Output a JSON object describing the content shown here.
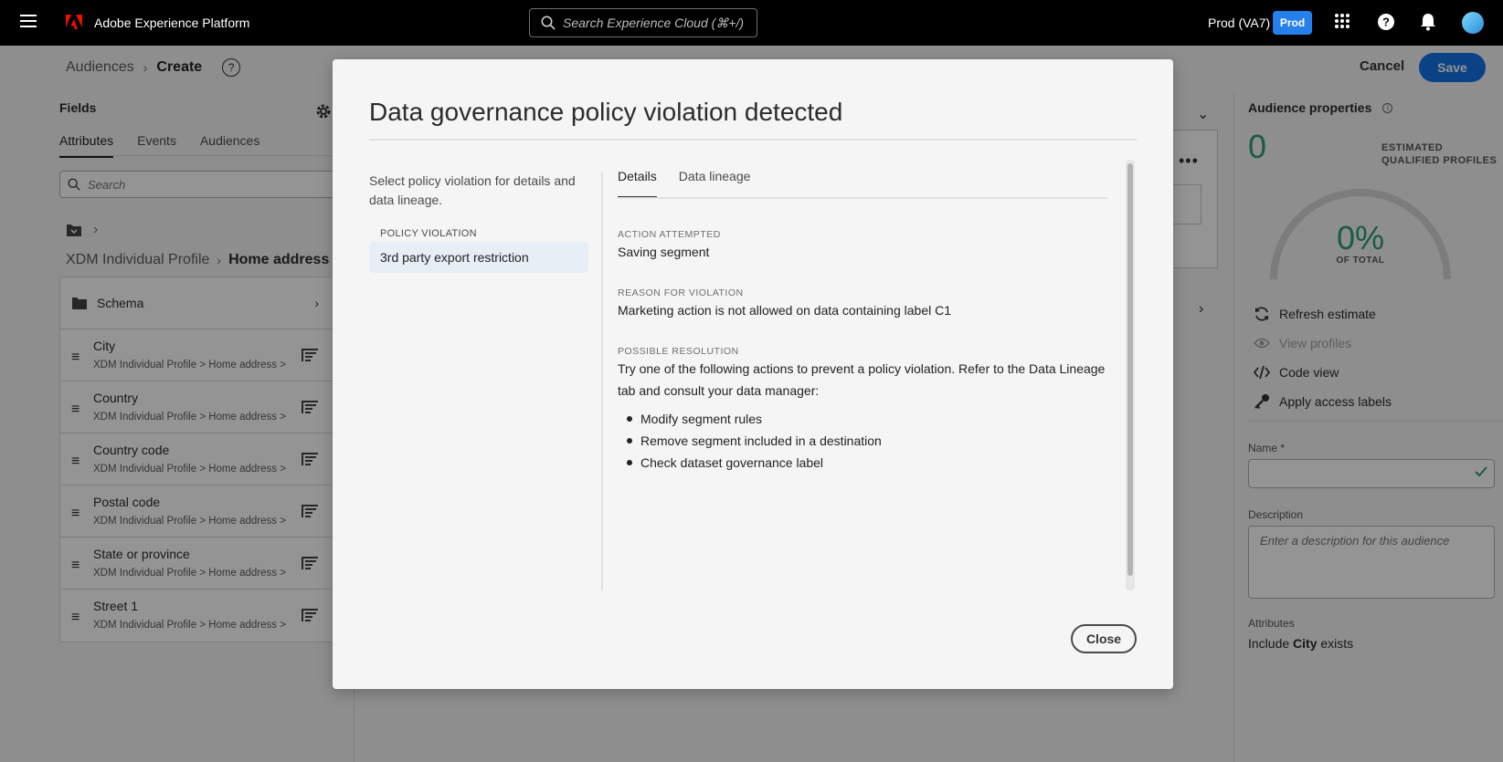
{
  "topbar": {
    "brand": "Adobe Experience Platform",
    "search_placeholder": "Search Experience Cloud (⌘+/)",
    "org": "Prod (VA7)",
    "env_badge": "Prod"
  },
  "header": {
    "breadcrumb_parent": "Audiences",
    "breadcrumb_current": "Create",
    "cancel_label": "Cancel",
    "save_label": "Save"
  },
  "fields": {
    "title": "Fields",
    "tabs": [
      "Attributes",
      "Events",
      "Audiences"
    ],
    "search_placeholder": "Search",
    "path_parent": "XDM Individual Profile",
    "path_current": "Home address",
    "schema_label": "Schema",
    "items": [
      {
        "name": "City",
        "path": "XDM Individual Profile > Home address >"
      },
      {
        "name": "Country",
        "path": "XDM Individual Profile > Home address >"
      },
      {
        "name": "Country code",
        "path": "XDM Individual Profile > Home address >"
      },
      {
        "name": "Postal code",
        "path": "XDM Individual Profile > Home address >"
      },
      {
        "name": "State or province",
        "path": "XDM Individual Profile > Home address >"
      },
      {
        "name": "Street 1",
        "path": "XDM Individual Profile > Home address >"
      }
    ]
  },
  "properties": {
    "title": "Audience properties",
    "count": "0",
    "estimated_line1": "ESTIMATED",
    "estimated_line2": "QUALIFIED PROFILES",
    "percent": "0%",
    "percent_label": "OF TOTAL",
    "actions": [
      "Refresh estimate",
      "View profiles",
      "Code view",
      "Apply access labels"
    ],
    "name_label": "Name *",
    "description_label": "Description",
    "description_placeholder": "Enter a description for this audience",
    "attributes_label": "Attributes",
    "attributes_prefix": "Include",
    "attributes_field": "City",
    "attributes_suffix": "exists"
  },
  "modal": {
    "title": "Data governance policy violation detected",
    "intro": "Select policy violation for details and data lineage.",
    "policy_violation_label": "POLICY VIOLATION",
    "policy_violation_item": "3rd party export restriction",
    "tabs": [
      "Details",
      "Data lineage"
    ],
    "action_attempted_label": "ACTION ATTEMPTED",
    "action_attempted_value": "Saving segment",
    "reason_label": "REASON FOR VIOLATION",
    "reason_value": "Marketing action is not allowed on data containing label C1",
    "resolution_label": "POSSIBLE RESOLUTION",
    "resolution_text": "Try one of the following actions to prevent a policy violation. Refer to the Data Lineage tab and consult your data manager:",
    "resolution_items": [
      "Modify segment rules",
      "Remove segment included in a destination",
      "Check dataset governance label"
    ],
    "close_label": "Close"
  },
  "colors": {
    "accent": "#1473e6",
    "env_badge": "#2680eb",
    "positive": "#2d9d78",
    "adobe_red": "#eb1000"
  }
}
